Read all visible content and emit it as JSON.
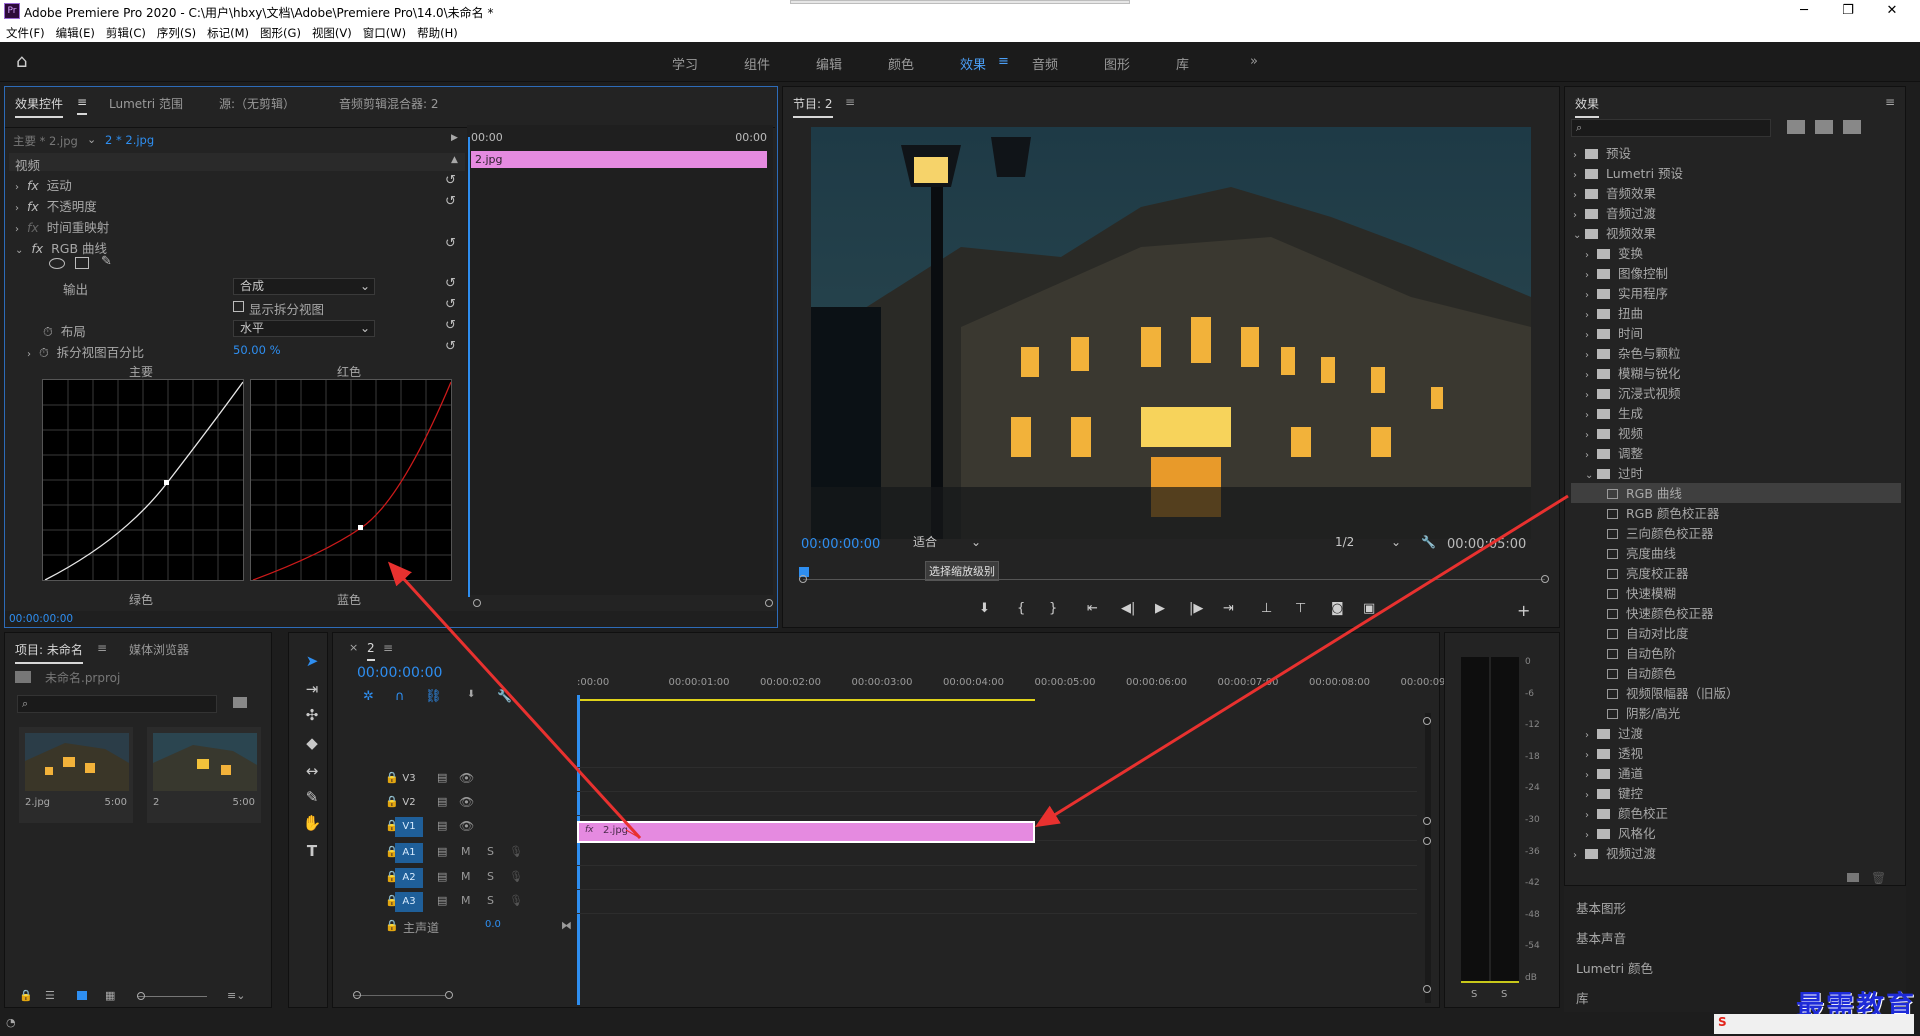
{
  "title": "Adobe Premiere Pro 2020 - C:\\用户\\hbxy\\文档\\Adobe\\Premiere Pro\\14.0\\未命名 *",
  "logo_text": "Pr",
  "menu": [
    "文件(F)",
    "编辑(E)",
    "剪辑(C)",
    "序列(S)",
    "标记(M)",
    "图形(G)",
    "视图(V)",
    "窗口(W)",
    "帮助(H)"
  ],
  "workspaces": [
    "学习",
    "组件",
    "编辑",
    "颜色",
    "效果",
    "音频",
    "图形",
    "库"
  ],
  "workspace_more": "»",
  "effect_controls": {
    "tabs": [
      "效果控件",
      "Lumetri 范围",
      "源:（无剪辑）",
      "音频剪辑混合器: 2"
    ],
    "master": "主要 * 2.jpg",
    "clip": "2 * 2.jpg",
    "t0": "00:00",
    "t1": "00:00",
    "clipname": "2.jpg",
    "video": "视频",
    "props": [
      "运动",
      "不透明度",
      "时间重映射",
      "RGB 曲线"
    ],
    "output_label": "输出",
    "output_value": "合成",
    "split_label": "显示拆分视图",
    "layout_label": "布局",
    "layout_value": "水平",
    "pct_label": "拆分视图百分比",
    "pct_value": "50.00 %",
    "g1": "主要",
    "g2": "红色",
    "g3": "绿色",
    "g4": "蓝色",
    "time": "00:00:00:00"
  },
  "program": {
    "title": "节目: 2",
    "timecode": "00:00:00:00",
    "fit": "适合",
    "ratio": "1/2",
    "duration": "00:00:05:00",
    "tooltip": "选择缩放级别"
  },
  "effects_panel": {
    "title": "效果",
    "items": [
      {
        "label": "预设",
        "type": "folder",
        "level": 0
      },
      {
        "label": "Lumetri 预设",
        "type": "folder",
        "level": 0
      },
      {
        "label": "音频效果",
        "type": "folder",
        "level": 0
      },
      {
        "label": "音频过渡",
        "type": "folder",
        "level": 0
      },
      {
        "label": "视频效果",
        "type": "folder",
        "level": 0,
        "open": true
      },
      {
        "label": "变换",
        "type": "folder",
        "level": 1
      },
      {
        "label": "图像控制",
        "type": "folder",
        "level": 1
      },
      {
        "label": "实用程序",
        "type": "folder",
        "level": 1
      },
      {
        "label": "扭曲",
        "type": "folder",
        "level": 1
      },
      {
        "label": "时间",
        "type": "folder",
        "level": 1
      },
      {
        "label": "杂色与颗粒",
        "type": "folder",
        "level": 1
      },
      {
        "label": "模糊与锐化",
        "type": "folder",
        "level": 1
      },
      {
        "label": "沉浸式视频",
        "type": "folder",
        "level": 1
      },
      {
        "label": "生成",
        "type": "folder",
        "level": 1
      },
      {
        "label": "视频",
        "type": "folder",
        "level": 1
      },
      {
        "label": "调整",
        "type": "folder",
        "level": 1
      },
      {
        "label": "过时",
        "type": "folder",
        "level": 1,
        "open": true
      },
      {
        "label": "RGB 曲线",
        "type": "effect",
        "level": 2,
        "selected": true
      },
      {
        "label": "RGB 颜色校正器",
        "type": "effect",
        "level": 2
      },
      {
        "label": "三向颜色校正器",
        "type": "effect",
        "level": 2
      },
      {
        "label": "亮度曲线",
        "type": "effect",
        "level": 2
      },
      {
        "label": "亮度校正器",
        "type": "effect",
        "level": 2
      },
      {
        "label": "快速模糊",
        "type": "effect",
        "level": 2
      },
      {
        "label": "快速颜色校正器",
        "type": "effect",
        "level": 2
      },
      {
        "label": "自动对比度",
        "type": "effect",
        "level": 2
      },
      {
        "label": "自动色阶",
        "type": "effect",
        "level": 2
      },
      {
        "label": "自动颜色",
        "type": "effect",
        "level": 2
      },
      {
        "label": "视频限幅器（旧版）",
        "type": "effect",
        "level": 2
      },
      {
        "label": "阴影/高光",
        "type": "effect",
        "level": 2
      },
      {
        "label": "过渡",
        "type": "folder",
        "level": 1
      },
      {
        "label": "透视",
        "type": "folder",
        "level": 1
      },
      {
        "label": "通道",
        "type": "folder",
        "level": 1
      },
      {
        "label": "键控",
        "type": "folder",
        "level": 1
      },
      {
        "label": "颜色校正",
        "type": "folder",
        "level": 1
      },
      {
        "label": "风格化",
        "type": "folder",
        "level": 1
      },
      {
        "label": "视频过渡",
        "type": "folder",
        "level": 0
      }
    ],
    "bottom_panels": [
      "基本图形",
      "基本声音",
      "Lumetri 颜色",
      "库"
    ]
  },
  "project": {
    "tabs": [
      "项目: 未命名",
      "媒体浏览器"
    ],
    "file": "未命名.prproj",
    "items": [
      {
        "name": "2.jpg",
        "dur": "5:00"
      },
      {
        "name": "2",
        "dur": "5:00"
      }
    ]
  },
  "timeline": {
    "tab": "2",
    "timecode": "00:00:00:00",
    "ruler": [
      ":00:00",
      "00:00:01:00",
      "00:00:02:00",
      "00:00:03:00",
      "00:00:04:00",
      "00:00:05:00",
      "00:00:06:00",
      "00:00:07:00",
      "00:00:08:00",
      "00:00:09:"
    ],
    "vtracks": [
      "V3",
      "V2",
      "V1"
    ],
    "atracks": [
      "A1",
      "A2",
      "A3"
    ],
    "master": "主声道",
    "master_val": "0.0",
    "clip": "2.jpg",
    "fx": "fx"
  },
  "meter": {
    "scale": [
      "0",
      "-6",
      "-12",
      "-18",
      "-24",
      "-30",
      "-36",
      "-42",
      "-48",
      "-54",
      "dB"
    ],
    "s": "S"
  },
  "watermark": "最需教育",
  "colors": {
    "accent": "#2e8ef0",
    "clip": "#e58ae0",
    "arrow": "#e8312f"
  }
}
